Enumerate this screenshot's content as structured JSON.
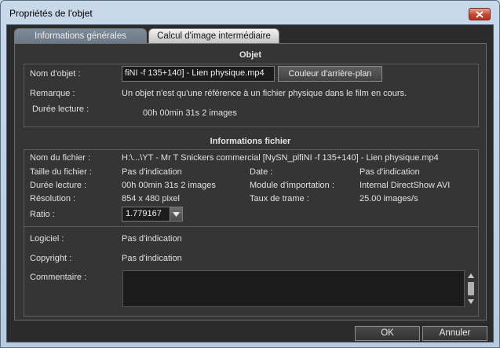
{
  "window": {
    "title": "Propriétés de l'objet",
    "close_icon": "close-icon"
  },
  "tabs": [
    {
      "label": "Informations générales",
      "active": true
    },
    {
      "label": "Calcul d'image intermédiaire",
      "active": false
    }
  ],
  "objet": {
    "header": "Objet",
    "name_label": "Nom d'objet :",
    "name_value": "fiNI -f 135+140] - Lien physique.mp4",
    "bg_button": "Couleur d'arrière-plan",
    "remark_label": "Remarque :",
    "remark_value": "Un objet n'est qu'une référence à un fichier physique dans le film en cours.",
    "duration_label": "Durée lecture :",
    "duration_value": "00h 00min 31s 2 images"
  },
  "fichier": {
    "header": "Informations fichier",
    "filename_label": "Nom du fichier :",
    "filename_value": "H:\\...\\YT - Mr T Snickers commercial [NySN_plfiNI -f 135+140] - Lien physique.mp4",
    "size_label": "Taille du fichier :",
    "size_value": "Pas d'indication",
    "date_label": "Date :",
    "date_value": "Pas d'indication",
    "duration_label": "Durée lecture :",
    "duration_value": "00h 00min 31s 2 images",
    "import_label": "Module d'importation :",
    "import_value": "Internal DirectShow AVI",
    "resolution_label": "Résolution :",
    "resolution_value": "854 x 480 pixel",
    "framerate_label": "Taux de trame :",
    "framerate_value": "25.00 images/s",
    "ratio_label": "Ratio :",
    "ratio_value": "1.779167",
    "software_label": "Logiciel :",
    "software_value": "Pas d'indication",
    "copyright_label": "Copyright :",
    "copyright_value": "Pas d'indication",
    "comment_label": "Commentaire :",
    "comment_value": ""
  },
  "footer": {
    "ok": "OK",
    "cancel": "Annuler"
  },
  "colors": {
    "panel_bg": "#353535",
    "client_bg": "#2b2b2b",
    "close_red": "#c7462f"
  }
}
